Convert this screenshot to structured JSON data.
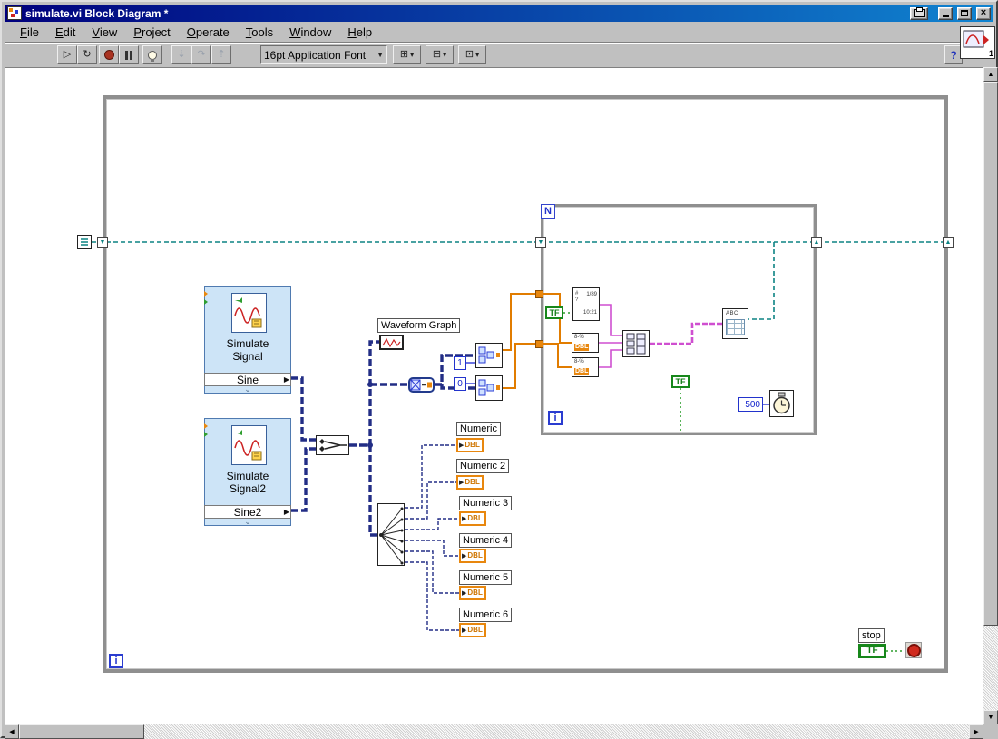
{
  "window": {
    "title": "simulate.vi Block Diagram *"
  },
  "menu": {
    "items": [
      "File",
      "Edit",
      "View",
      "Project",
      "Operate",
      "Tools",
      "Window",
      "Help"
    ]
  },
  "toolbar": {
    "font_selector": "16pt Application Font",
    "help_label": "?",
    "vi_icon_badge": "1"
  },
  "diagram": {
    "while_loop": {
      "iteration_label": "i"
    },
    "for_loop": {
      "count_label": "N",
      "iteration_label": "i"
    },
    "express_vi_1": {
      "title_line1": "Simulate",
      "title_line2": "Signal",
      "output": "Sine"
    },
    "express_vi_2": {
      "title_line1": "Simulate",
      "title_line2": "Signal2",
      "output": "Sine2"
    },
    "waveform_graph": {
      "label": "Waveform Graph"
    },
    "index_constants": {
      "one": "1",
      "zero": "0"
    },
    "numerics": [
      {
        "label": "Numeric",
        "type": "DBL"
      },
      {
        "label": "Numeric 2",
        "type": "DBL"
      },
      {
        "label": "Numeric 3",
        "type": "DBL"
      },
      {
        "label": "Numeric 4",
        "type": "DBL"
      },
      {
        "label": "Numeric 5",
        "type": "DBL"
      },
      {
        "label": "Numeric 6",
        "type": "DBL"
      }
    ],
    "format_block": {
      "text1": "1/89",
      "text2": "10:21"
    },
    "number_to_string_1": {
      "text": "8-%",
      "type": "DBL"
    },
    "number_to_string_2": {
      "text": "8-%",
      "type": "DBL"
    },
    "true_constant_1": "TF",
    "true_constant_2": "TF",
    "table_block": {
      "text": "ABC"
    },
    "wait_ms": {
      "value": "500"
    },
    "stop": {
      "label": "stop",
      "terminal": "TF"
    }
  },
  "colors": {
    "express_blue": "#cde4f7",
    "wire_dynamic": "#222d85",
    "wire_teal": "#0d8383",
    "wire_orange": "#e17c00",
    "wire_pink": "#cf4fd0",
    "tf_green": "#17871b",
    "dbl_orange": "#e8870e"
  }
}
